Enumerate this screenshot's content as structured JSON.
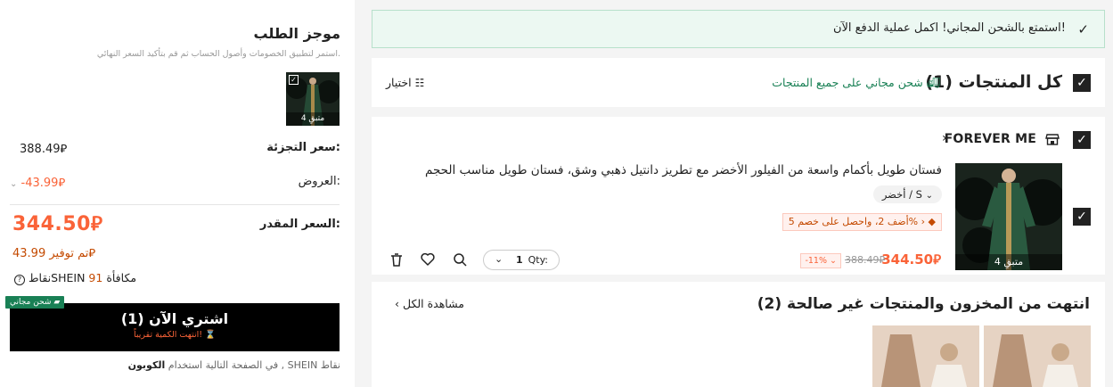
{
  "summary": {
    "title": "موجز الطلب",
    "subtitle": "استمر لتطبيق الخصومات وأصول الحساب ثم قم بتأكيد السعر النهائي.",
    "thumb_tag": "متبقِ 4",
    "retail_label": "سعر التجزئة:",
    "retail_value": "388.49⃁",
    "offers_label": "العروض:",
    "offers_value": "-43.99⃁",
    "final_label": "السعر المقدر:",
    "final_value": "344.50⃁",
    "saved": "تم توفير 43.99⃁",
    "points_prefix": "مكافأة",
    "points_num": "91",
    "points_suffix": "نقاطSHEIN",
    "free_badge": "شحن مجاني",
    "buy_label": "اشتري الآن (1)",
    "buy_sub": "انتهت الكمية تقريباً!",
    "coupon_prefix": "في الصفحة التالية استخدام",
    "coupon_bold": "الكوبون",
    "coupon_suffix": ", SHEIN نقاط"
  },
  "banner": {
    "text": "استمتع بالشحن المجاني! اكمل عملية الدفع الآن!"
  },
  "cart": {
    "all_label": "كل المنتجات (1)",
    "free_shipping": "شحن مجاني على جميع المنتجات",
    "select_label": "اختيار",
    "store_name": "FOREVER ME",
    "product": {
      "name": "فستان طويل بأكمام واسعة من الفيلور الأخضر مع تطريز دانتيل ذهبي وشق، فستان طويل مناسب الحجم",
      "variant": "أخضر / S",
      "promo": "أضف 2، واحصل على خصم 5% ›",
      "thumb_tag": "متبقِ 4",
      "price": "344.50⃁",
      "old_price": "388.49⃁",
      "discount": "-11%",
      "qty_label": "Qty:",
      "qty_value": "1"
    },
    "out_of_stock_title": "انتهت من المخزون والمنتجات غير صالحة (2)",
    "view_all": "مشاهدة الكل"
  },
  "colors": {
    "accent": "#fa6338",
    "green": "#198055",
    "banner_bg": "#ecf8f2"
  }
}
